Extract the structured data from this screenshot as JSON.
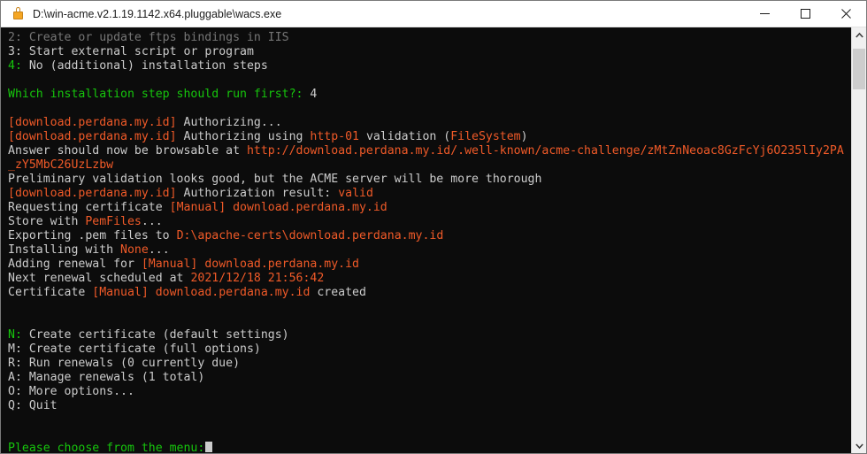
{
  "window": {
    "title": "D:\\win-acme.v2.1.19.1142.x64.pluggable\\wacs.exe",
    "lock_icon": "lock-icon",
    "minimize_label": "—",
    "maximize_label": "☐",
    "close_label": "✕"
  },
  "colors": {
    "background": "#0c0c0c",
    "white": "#cccccc",
    "grey": "#767676",
    "green": "#16c60c",
    "orange": "#f05a28",
    "titlebar": "#ffffff",
    "scrollbar_track": "#f0f0f0",
    "scrollbar_thumb": "#cdcdcd"
  },
  "scrollbar": {
    "up_arrow": "scroll-up-arrow",
    "down_arrow": "scroll-down-arrow",
    "thumb": "scroll-thumb"
  },
  "console": {
    "prompt_cursor": "block-cursor",
    "lines": [
      {
        "segments": [
          {
            "t": "2: Create or update ftps bindings in IIS",
            "c": "c-grey"
          }
        ]
      },
      {
        "segments": [
          {
            "t": "3:",
            "c": "c-white"
          },
          {
            "t": " Start external script or program",
            "c": "c-white"
          }
        ]
      },
      {
        "segments": [
          {
            "t": "4:",
            "c": "c-green"
          },
          {
            "t": " No (additional) installation steps",
            "c": "c-white"
          }
        ]
      },
      {
        "segments": [
          {
            "t": "",
            "c": "c-white"
          }
        ]
      },
      {
        "segments": [
          {
            "t": "Which installation step should run first?:",
            "c": "c-green"
          },
          {
            "t": " 4",
            "c": "c-white"
          }
        ]
      },
      {
        "segments": [
          {
            "t": "",
            "c": "c-white"
          }
        ]
      },
      {
        "segments": [
          {
            "t": "[download.perdana.my.id]",
            "c": "c-orange"
          },
          {
            "t": " Authorizing...",
            "c": "c-white"
          }
        ]
      },
      {
        "segments": [
          {
            "t": "[download.perdana.my.id]",
            "c": "c-orange"
          },
          {
            "t": " Authorizing using ",
            "c": "c-white"
          },
          {
            "t": "http-01",
            "c": "c-orange"
          },
          {
            "t": " validation (",
            "c": "c-white"
          },
          {
            "t": "FileSystem",
            "c": "c-orange"
          },
          {
            "t": ")",
            "c": "c-white"
          }
        ]
      },
      {
        "segments": [
          {
            "t": "Answer should now be browsable at ",
            "c": "c-white"
          },
          {
            "t": "http://download.perdana.my.id/.well-known/acme-challenge/zMtZnNeoac8GzFcYj6O235lIy2PA",
            "c": "c-orange"
          }
        ]
      },
      {
        "segments": [
          {
            "t": "_zY5MbC26UzLzbw",
            "c": "c-orange"
          }
        ]
      },
      {
        "segments": [
          {
            "t": "Preliminary validation looks good, but the ACME server will be more thorough",
            "c": "c-white"
          }
        ]
      },
      {
        "segments": [
          {
            "t": "[download.perdana.my.id]",
            "c": "c-orange"
          },
          {
            "t": " Authorization result: ",
            "c": "c-white"
          },
          {
            "t": "valid",
            "c": "c-orange"
          }
        ]
      },
      {
        "segments": [
          {
            "t": "Requesting certificate ",
            "c": "c-white"
          },
          {
            "t": "[Manual] download.perdana.my.id",
            "c": "c-orange"
          }
        ]
      },
      {
        "segments": [
          {
            "t": "Store with ",
            "c": "c-white"
          },
          {
            "t": "PemFiles",
            "c": "c-orange"
          },
          {
            "t": "...",
            "c": "c-white"
          }
        ]
      },
      {
        "segments": [
          {
            "t": "Exporting .pem files to ",
            "c": "c-white"
          },
          {
            "t": "D:\\apache-certs\\download.perdana.my.id",
            "c": "c-orange"
          }
        ]
      },
      {
        "segments": [
          {
            "t": "Installing with ",
            "c": "c-white"
          },
          {
            "t": "None",
            "c": "c-orange"
          },
          {
            "t": "...",
            "c": "c-white"
          }
        ]
      },
      {
        "segments": [
          {
            "t": "Adding renewal for ",
            "c": "c-white"
          },
          {
            "t": "[Manual] download.perdana.my.id",
            "c": "c-orange"
          }
        ]
      },
      {
        "segments": [
          {
            "t": "Next renewal scheduled at ",
            "c": "c-white"
          },
          {
            "t": "2021/12/18 21:56:42",
            "c": "c-orange"
          }
        ]
      },
      {
        "segments": [
          {
            "t": "Certificate ",
            "c": "c-white"
          },
          {
            "t": "[Manual] download.perdana.my.id",
            "c": "c-orange"
          },
          {
            "t": " created",
            "c": "c-white"
          }
        ]
      },
      {
        "segments": [
          {
            "t": "",
            "c": "c-white"
          }
        ]
      },
      {
        "segments": [
          {
            "t": "",
            "c": "c-white"
          }
        ]
      },
      {
        "segments": [
          {
            "t": "N:",
            "c": "c-green"
          },
          {
            "t": " Create certificate (default settings)",
            "c": "c-white"
          }
        ]
      },
      {
        "segments": [
          {
            "t": "M: Create certificate (full options)",
            "c": "c-white"
          }
        ]
      },
      {
        "segments": [
          {
            "t": "R: Run renewals (0 currently due)",
            "c": "c-white"
          }
        ]
      },
      {
        "segments": [
          {
            "t": "A: Manage renewals (1 total)",
            "c": "c-white"
          }
        ]
      },
      {
        "segments": [
          {
            "t": "O: More options...",
            "c": "c-white"
          }
        ]
      },
      {
        "segments": [
          {
            "t": "Q: Quit",
            "c": "c-white"
          }
        ]
      },
      {
        "segments": [
          {
            "t": "",
            "c": "c-white"
          }
        ]
      },
      {
        "segments": [
          {
            "t": "",
            "c": "c-white"
          }
        ]
      },
      {
        "segments": [
          {
            "t": "Please choose from the menu:",
            "c": "c-green"
          }
        ],
        "cursor": true
      }
    ]
  }
}
